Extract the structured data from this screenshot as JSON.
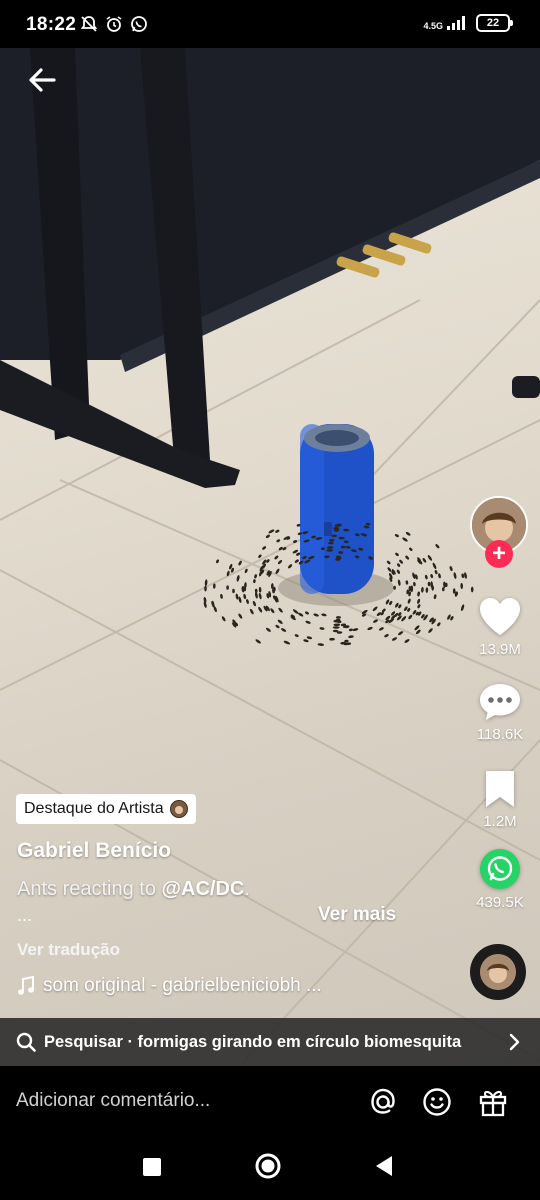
{
  "status": {
    "time": "18:22",
    "network": "4.5G",
    "battery": "22"
  },
  "video": {
    "back_label": "Voltar"
  },
  "rail": {
    "likes": "13.9M",
    "comments": "118.6K",
    "saves": "1.2M",
    "shares": "439.5K",
    "follow": "+"
  },
  "caption": {
    "badge": "Destaque do Artista",
    "author": "Gabriel Benício",
    "text": "Ants reacting to ",
    "mention": "@AC/DC",
    "text_end": ".",
    "ellipsis": "...",
    "see_more": "Ver mais",
    "translate": "Ver tradução",
    "sound": "som original - gabrielbeniciobh ..."
  },
  "search": {
    "text": "Pesquisar · formigas girando em círculo biomesquita"
  },
  "comment": {
    "placeholder": "Adicionar comentário..."
  },
  "colors": {
    "accent": "#fe2c55",
    "whatsapp": "#25d366"
  },
  "icons": [
    "back-arrow-icon",
    "heart-icon",
    "comment-icon",
    "bookmark-icon",
    "whatsapp-icon",
    "search-icon",
    "chevron-right-icon",
    "at-icon",
    "emoji-icon",
    "gift-icon",
    "music-note-icon"
  ]
}
